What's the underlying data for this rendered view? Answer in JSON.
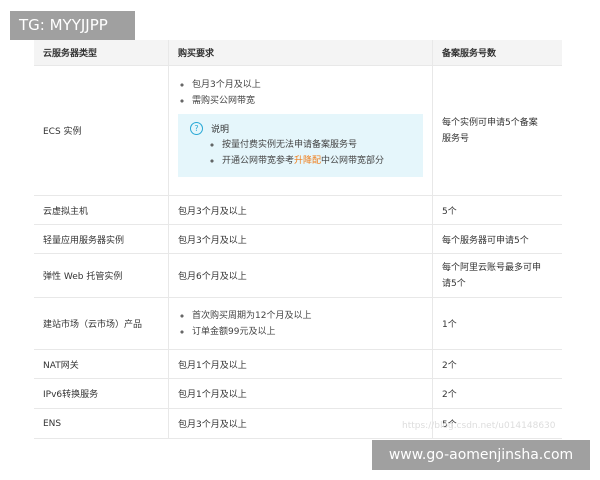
{
  "watermarks": {
    "top": "TG: MYYJJPP",
    "bottom": "www.go-aomenjinsha.com",
    "url": "https://blog.csdn.net/u014148630"
  },
  "headers": [
    "云服务器类型",
    "购买要求",
    "备案服务号数"
  ],
  "ecs": {
    "type": "ECS 实例",
    "reqs": [
      "包月3个月及以上",
      "需购买公网带宽"
    ],
    "note_title": "说明",
    "note_items": [
      "按量付费实例无法申请备案服务号"
    ],
    "note_item2_pre": "开通公网带宽参考",
    "note_item2_link": "升降配",
    "note_item2_post": "中公网带宽部分",
    "count": "每个实例可申请5个备案服务号"
  },
  "rows": [
    {
      "type": "云虚拟主机",
      "req": "包月3个月及以上",
      "count": "5个"
    },
    {
      "type": "轻量应用服务器实例",
      "req": "包月3个月及以上",
      "count": "每个服务器可申请5个"
    },
    {
      "type": "弹性 Web 托管实例",
      "req": "包月6个月及以上",
      "count": "每个阿里云账号最多可申请5个"
    }
  ],
  "market": {
    "type": "建站市场（云市场）产品",
    "reqs": [
      "首次购买周期为12个月及以上",
      "订单金额99元及以上"
    ],
    "count": "1个"
  },
  "rows2": [
    {
      "type": "NAT网关",
      "req": "包月1个月及以上",
      "count": "2个"
    },
    {
      "type": "IPv6转换服务",
      "req": "包月1个月及以上",
      "count": "2个"
    },
    {
      "type": "ENS",
      "req": "包月3个月及以上",
      "count": "5个"
    }
  ],
  "colors": {
    "link": "#f07c17",
    "note_bg": "#e5f6fb",
    "header_bg": "#f4f4f4"
  }
}
